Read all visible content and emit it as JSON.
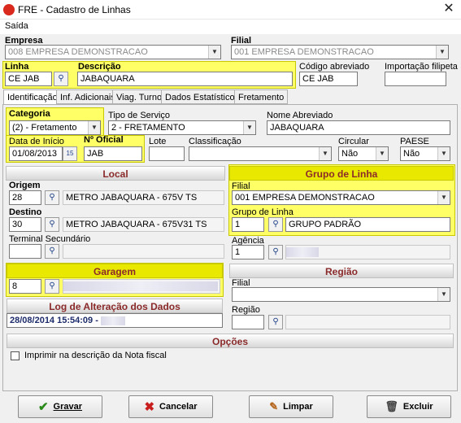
{
  "window": {
    "title": "FRE - Cadastro de Linhas",
    "close": "✕"
  },
  "menu": {
    "saida": "Saída"
  },
  "top": {
    "empresa_label": "Empresa",
    "empresa_value": "008 EMPRESA DEMONSTRACAO",
    "filial_label": "Filial",
    "filial_value": "001 EMPRESA DEMONSTRACAO",
    "linha_label": "Linha",
    "linha_value": "CE JAB",
    "descricao_label": "Descrição",
    "descricao_value": "JABAQUARA",
    "codigo_label": "Código abreviado",
    "codigo_value": "CE JAB",
    "importacao_label": "Importação filipeta",
    "importacao_value": ""
  },
  "tabs": [
    "Identificação",
    "Inf. Adicionais",
    "Viag. Turno",
    "Dados Estatísticos",
    "Fretamento"
  ],
  "ident": {
    "categoria_label": "Categoria",
    "categoria_value": "(2) - Fretamento",
    "tipo_label": "Tipo de Serviço",
    "tipo_value": "2 - FRETAMENTO",
    "nome_label": "Nome Abreviado",
    "nome_value": "JABAQUARA",
    "data_label": "Data de Início",
    "data_value": "01/08/2013",
    "oficial_label": "Nº Oficial",
    "oficial_value": "JAB",
    "lote_label": "Lote",
    "lote_value": "",
    "classif_label": "Classificação",
    "classif_value": "",
    "circular_label": "Circular",
    "circular_value": "Não",
    "paese_label": "PAESE",
    "paese_value": "Não"
  },
  "local": {
    "header": "Local",
    "origem_label": "Origem",
    "origem_code": "28",
    "origem_desc": "METRO JABAQUARA - 675V TS",
    "destino_label": "Destino",
    "destino_code": "30",
    "destino_desc": "METRO JABAQUARA - 675V31 TS",
    "terminal_label": "Terminal Secundário",
    "terminal_value": ""
  },
  "grupo": {
    "header": "Grupo de Linha",
    "filial_label": "Filial",
    "filial_value": "001 EMPRESA DEMONSTRACAO",
    "grupo_label": "Grupo de Linha",
    "grupo_code": "1",
    "grupo_desc": "GRUPO PADRÃO",
    "agencia_label": "Agência",
    "agencia_code": "1"
  },
  "garagem": {
    "header": "Garagem",
    "code": "8"
  },
  "regiao": {
    "header": "Região",
    "filial_label": "Filial",
    "filial_value": "",
    "regiao_label": "Região",
    "regiao_value": ""
  },
  "log": {
    "header": "Log de Alteração dos Dados",
    "value": "28/08/2014 15:54:09 - "
  },
  "opcoes": {
    "header": "Opções",
    "imprimir_label": "Imprimir na descrição da Nota fiscal"
  },
  "buttons": {
    "gravar": "Gravar",
    "cancelar": "Cancelar",
    "limpar": "Limpar",
    "excluir": "Excluir"
  },
  "colors": {
    "highlight": "#ffff66",
    "header_text": "#8b2a2a",
    "accent_red": "#d9281c"
  }
}
